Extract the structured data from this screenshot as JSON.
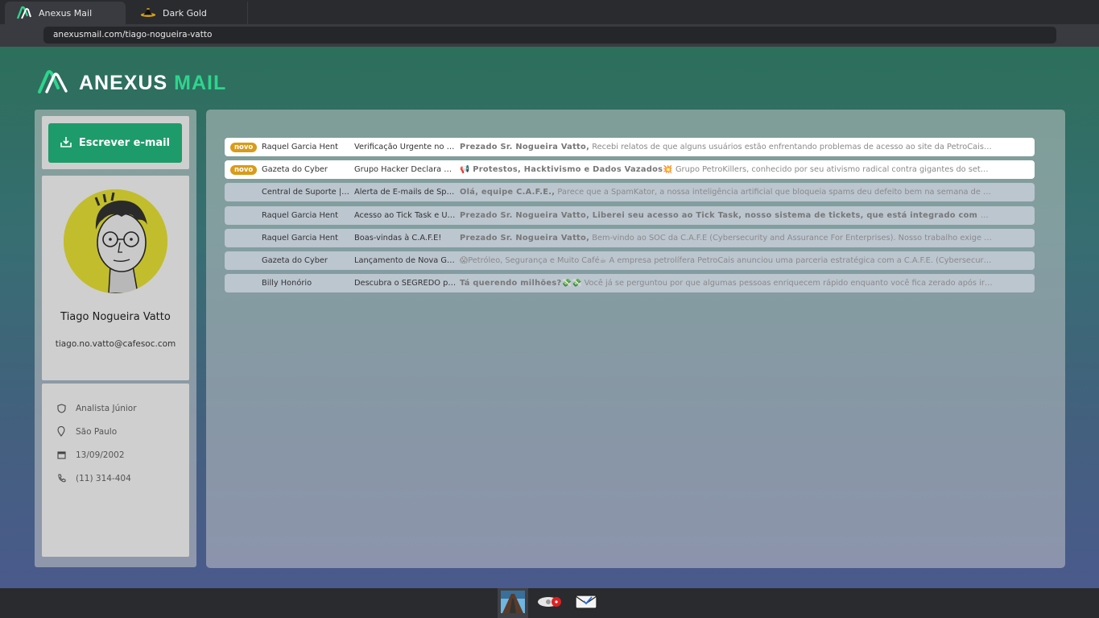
{
  "browser": {
    "tabs": [
      {
        "title": "Anexus Mail",
        "icon": "anexus-logo-icon",
        "active": true
      },
      {
        "title": "Dark Gold",
        "icon": "dark-gold-icon",
        "active": false
      }
    ],
    "url": "anexusmail.com/tiago-nogueira-vatto"
  },
  "logo": {
    "word1": "ANEXUS",
    "word2": "MAIL",
    "accent_color": "#2ed48d"
  },
  "sidebar": {
    "compose_label": "Escrever e-mail",
    "compose_icon": "compose-icon",
    "profile": {
      "name": "Tiago Nogueira Vatto",
      "email": "tiago.no.vatto@cafesoc.com"
    },
    "info": [
      {
        "icon": "shield-icon",
        "text": "Analista Júnior"
      },
      {
        "icon": "location-pin-icon",
        "text": "São Paulo"
      },
      {
        "icon": "calendar-icon",
        "text": "13/09/2002"
      },
      {
        "icon": "phone-icon",
        "text": "(11) 314-404"
      }
    ]
  },
  "inbox": {
    "emails": [
      {
        "badge": "novo",
        "unread": true,
        "sender": "Raquel Garcia Hent",
        "subject": "Verificação Urgente no S…",
        "preview_bold": "Prezado Sr. Nogueira Vatto,",
        "preview_text": "Recebi relatos de que alguns usuários estão enfrentando problemas de acesso ao site da PetroCais. Prec…"
      },
      {
        "badge": "novo",
        "unread": true,
        "sender": "Gazeta do Cyber",
        "subject": "Grupo Hacker Declara G…",
        "preview_bold": "📢 Protestos, Hacktivismo e Dados Vazados💥",
        "preview_text": "Grupo PetroKillers, conhecido por seu ativismo radical contra gigantes do setor ener…"
      },
      {
        "badge": "",
        "unread": false,
        "sender": "Central de Suporte | C.",
        "subject": "Alerta de E-mails de Spam",
        "preview_bold": "Olá, equipe C.A.F.E.,",
        "preview_text": "Parece que a SpamKator, a nossa inteligência artificial que bloqueia spams deu defeito bem na semana de folga …"
      },
      {
        "badge": "",
        "unread": false,
        "sender": "Raquel Garcia Hent",
        "subject": "Acesso ao Tick Task e Us…",
        "preview_bold": "Prezado Sr. Nogueira Vatto, Liberei seu acesso ao Tick Task, nosso sistema de tickets, que está integrado com o SIEMti…",
        "preview_text": ""
      },
      {
        "badge": "",
        "unread": false,
        "sender": "Raquel Garcia Hent",
        "subject": "Boas-vindas à C.A.F.E!",
        "preview_bold": "Prezado Sr. Nogueira Vatto,",
        "preview_text": "Bem-vindo ao SOC da C.A.F.E (Cybersecurity and Assurance For Enterprises). Nosso trabalho exige agili…"
      },
      {
        "badge": "",
        "unread": false,
        "sender": "Gazeta do Cyber",
        "subject": "Lançamento de Nova Ga…",
        "preview_bold": "",
        "preview_text": "😱Petróleo, Segurança e Muito Café☕ A empresa petrolífera PetroCais anunciou uma parceria estratégica com a C.A.F.E. (Cybersecurit…"
      },
      {
        "badge": "",
        "unread": false,
        "sender": "Billy Honório",
        "subject": "Descubra o SEGREDO p…",
        "preview_bold": "Tá querendo milhões?💸💸",
        "preview_text": "Você já se perguntou por que algumas pessoas enriquecem rápido enquanto você fica zerado após ir ao me…"
      }
    ]
  },
  "taskbar": {
    "items": [
      {
        "icon": "road-tunnel-app-icon",
        "active": true
      },
      {
        "icon": "eye-notification-app-icon",
        "active": false
      },
      {
        "icon": "mail-app-icon",
        "active": false
      }
    ]
  }
}
